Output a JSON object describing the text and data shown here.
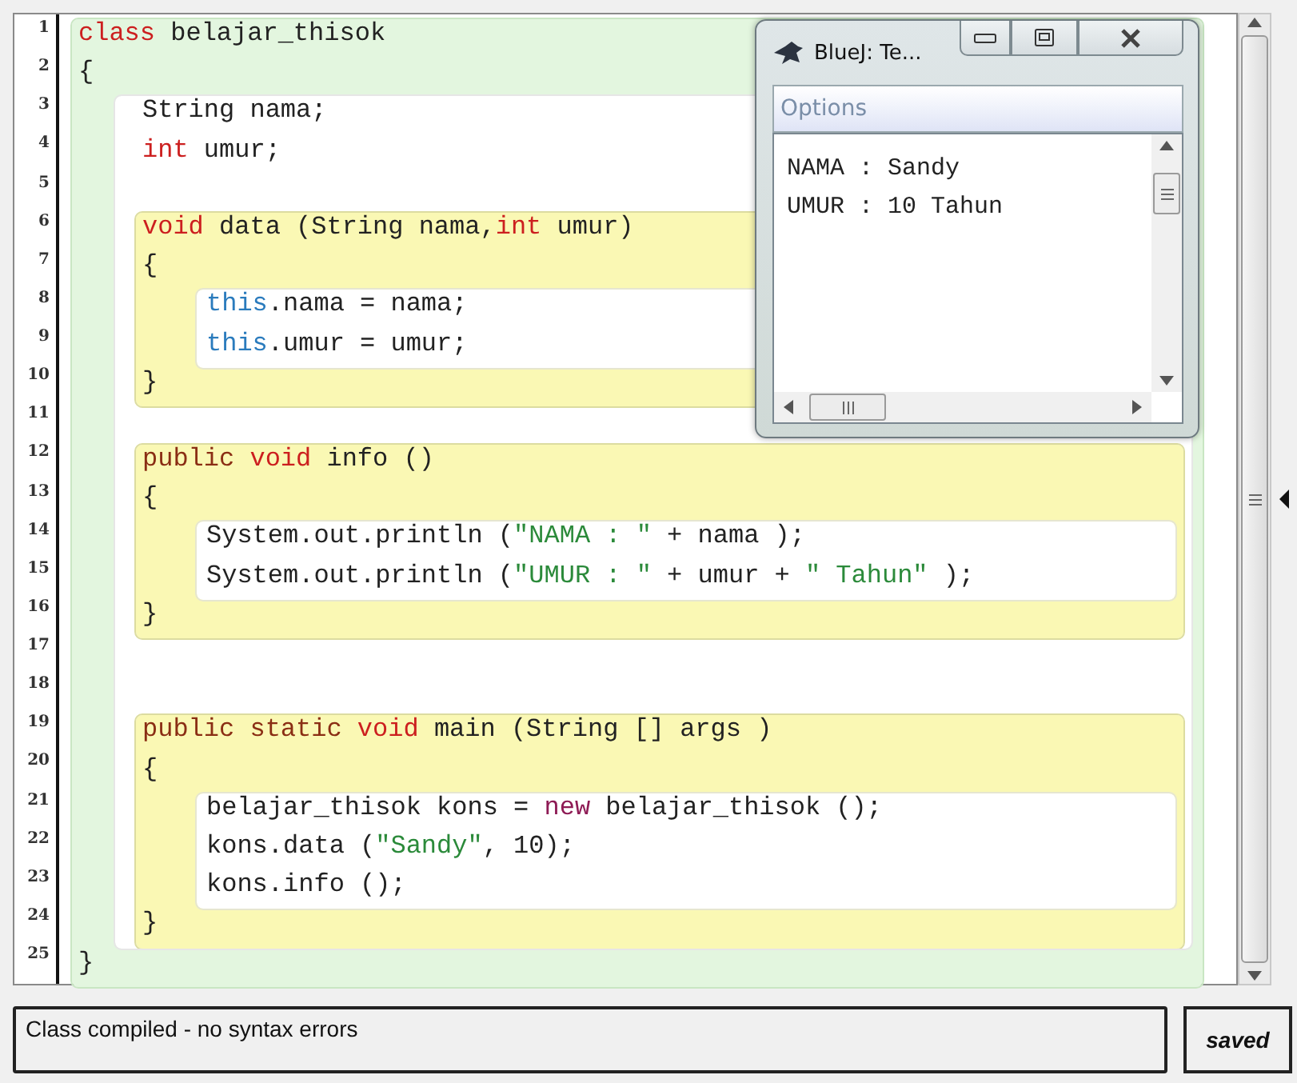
{
  "editor": {
    "gutter": [
      "1",
      "2",
      "3",
      "4",
      "5",
      "6",
      "7",
      "8",
      "9",
      "10",
      "11",
      "12",
      "13",
      "14",
      "15",
      "16",
      "17",
      "18",
      "19",
      "20",
      "21",
      "22",
      "23",
      "24",
      "25"
    ],
    "code": {
      "kind": "class_scope",
      "children": [
        {
          "kind": "line",
          "tokens": [
            {
              "kind": "keyword",
              "text": "class"
            },
            {
              "kind": "plain",
              "text": " belajar_thisok"
            }
          ]
        },
        {
          "kind": "line",
          "tokens": [
            {
              "kind": "plain",
              "text": "{"
            }
          ]
        },
        {
          "kind": "body_scope",
          "children": [
            {
              "kind": "line",
              "tokens": [
                {
                  "kind": "plain",
                  "text": "String nama;"
                }
              ]
            },
            {
              "kind": "line",
              "tokens": [
                {
                  "kind": "keyword",
                  "text": "int"
                },
                {
                  "kind": "plain",
                  "text": " umur;"
                }
              ]
            },
            {
              "kind": "line"
            },
            {
              "kind": "method_scope",
              "children": [
                {
                  "kind": "line",
                  "tokens": [
                    {
                      "kind": "keyword",
                      "text": "void"
                    },
                    {
                      "kind": "plain",
                      "text": " data (String nama,"
                    },
                    {
                      "kind": "keyword",
                      "text": "int"
                    },
                    {
                      "kind": "plain",
                      "text": " umur)"
                    }
                  ]
                },
                {
                  "kind": "line",
                  "tokens": [
                    {
                      "kind": "plain",
                      "text": "{"
                    }
                  ]
                },
                {
                  "kind": "method_body_scope",
                  "children": [
                    {
                      "kind": "line",
                      "tokens": [
                        {
                          "kind": "this",
                          "text": "this"
                        },
                        {
                          "kind": "plain",
                          "text": ".nama = nama;"
                        }
                      ]
                    },
                    {
                      "kind": "line",
                      "tokens": [
                        {
                          "kind": "this",
                          "text": "this"
                        },
                        {
                          "kind": "plain",
                          "text": ".umur = umur;"
                        }
                      ]
                    }
                  ]
                },
                {
                  "kind": "line",
                  "tokens": [
                    {
                      "kind": "plain",
                      "text": "}"
                    }
                  ]
                }
              ]
            },
            {
              "kind": "line"
            },
            {
              "kind": "method_scope",
              "children": [
                {
                  "kind": "line",
                  "tokens": [
                    {
                      "kind": "modifier",
                      "text": "public"
                    },
                    {
                      "kind": "keyword",
                      "text": " void"
                    },
                    {
                      "kind": "plain",
                      "text": " info ()"
                    }
                  ]
                },
                {
                  "kind": "line",
                  "tokens": [
                    {
                      "kind": "plain",
                      "text": "{"
                    }
                  ]
                },
                {
                  "kind": "method_body_scope",
                  "children": [
                    {
                      "kind": "line",
                      "tokens": [
                        {
                          "kind": "plain",
                          "text": "System.out.println ("
                        },
                        {
                          "kind": "string",
                          "text": "\"NAMA : \""
                        },
                        {
                          "kind": "plain",
                          "text": " + nama );"
                        }
                      ]
                    },
                    {
                      "kind": "line",
                      "tokens": [
                        {
                          "kind": "plain",
                          "text": "System.out.println ("
                        },
                        {
                          "kind": "string",
                          "text": "\"UMUR : \""
                        },
                        {
                          "kind": "plain",
                          "text": " + umur + "
                        },
                        {
                          "kind": "string",
                          "text": "\" Tahun\""
                        },
                        {
                          "kind": "plain",
                          "text": " );"
                        }
                      ]
                    }
                  ]
                },
                {
                  "kind": "line",
                  "tokens": [
                    {
                      "kind": "plain",
                      "text": "}"
                    }
                  ]
                }
              ]
            },
            {
              "kind": "line"
            },
            {
              "kind": "line"
            },
            {
              "kind": "method_scope",
              "children": [
                {
                  "kind": "line",
                  "tokens": [
                    {
                      "kind": "modifier",
                      "text": "public static"
                    },
                    {
                      "kind": "keyword",
                      "text": " void"
                    },
                    {
                      "kind": "plain",
                      "text": " main (String [] args )"
                    }
                  ]
                },
                {
                  "kind": "line",
                  "tokens": [
                    {
                      "kind": "plain",
                      "text": "{"
                    }
                  ]
                },
                {
                  "kind": "method_body_scope",
                  "children": [
                    {
                      "kind": "line",
                      "tokens": [
                        {
                          "kind": "plain",
                          "text": "belajar_thisok kons = "
                        },
                        {
                          "kind": "new",
                          "text": "new"
                        },
                        {
                          "kind": "plain",
                          "text": " belajar_thisok ();"
                        }
                      ]
                    },
                    {
                      "kind": "line",
                      "tokens": [
                        {
                          "kind": "plain",
                          "text": "kons.data ("
                        },
                        {
                          "kind": "string",
                          "text": "\"Sandy\""
                        },
                        {
                          "kind": "plain",
                          "text": ", 10);"
                        }
                      ]
                    },
                    {
                      "kind": "line",
                      "tokens": [
                        {
                          "kind": "plain",
                          "text": "kons.info ();"
                        }
                      ]
                    }
                  ]
                },
                {
                  "kind": "line",
                  "tokens": [
                    {
                      "kind": "plain",
                      "text": "}"
                    }
                  ]
                }
              ]
            }
          ]
        },
        {
          "kind": "line",
          "tokens": [
            {
              "kind": "plain",
              "text": "}"
            }
          ]
        }
      ]
    }
  },
  "output_window": {
    "title": "BlueJ: Te...",
    "menu": [
      "Options"
    ],
    "lines": [
      "NAMA : Sandy",
      "UMUR : 10 Tahun"
    ]
  },
  "status": {
    "message": "Class compiled - no syntax errors",
    "saved_label": "saved"
  }
}
